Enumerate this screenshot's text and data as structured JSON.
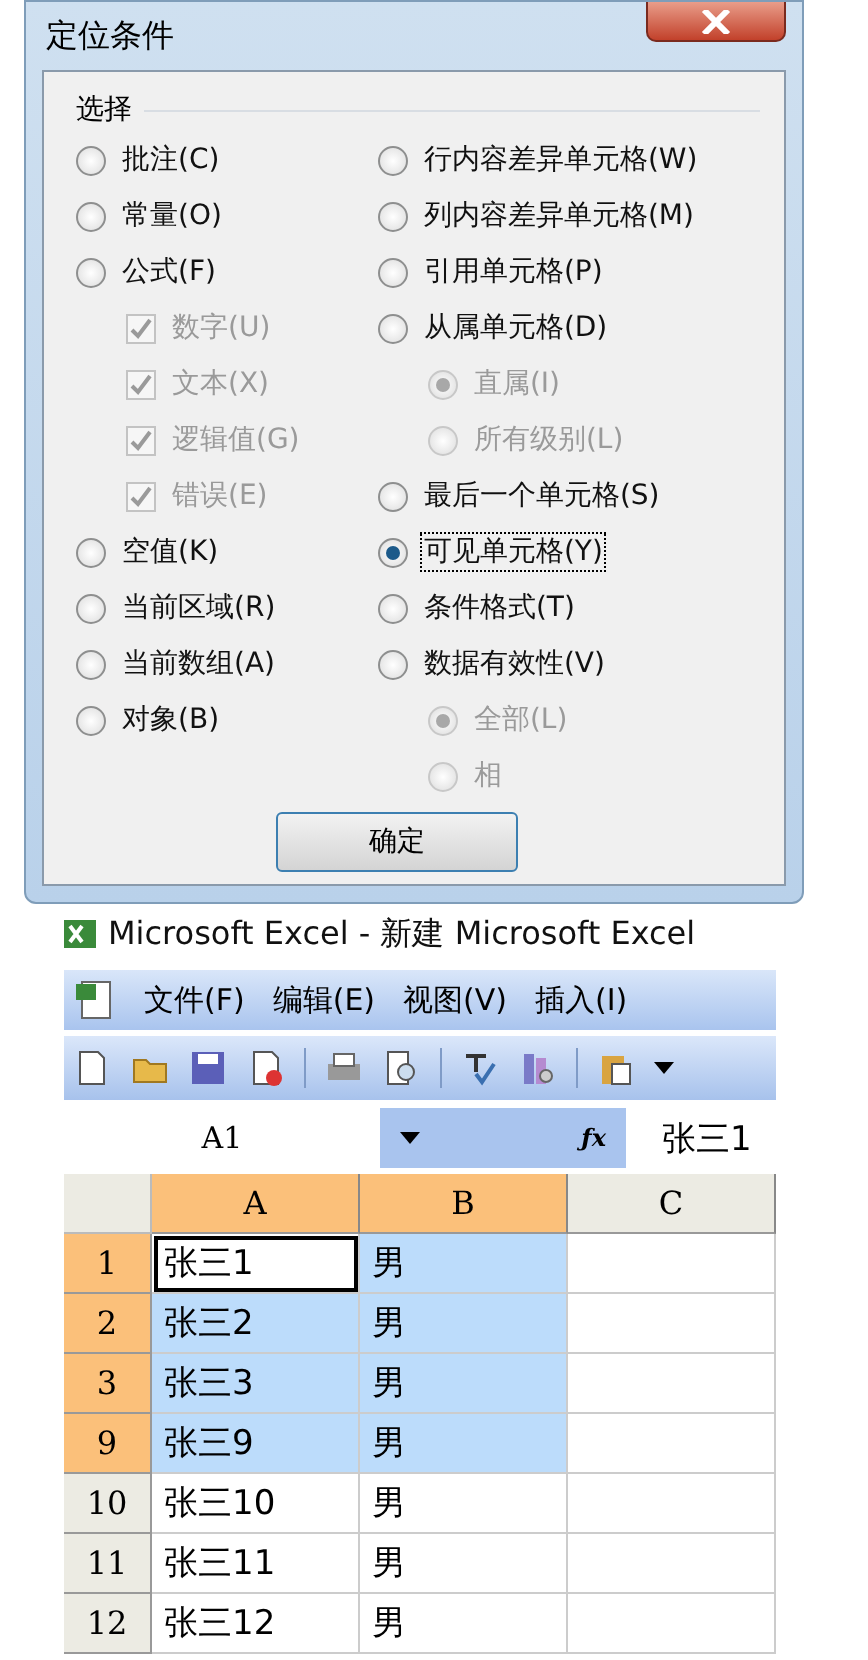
{
  "dialog": {
    "title": "定位条件",
    "group_label": "选择",
    "left_options": [
      {
        "label": "批注(C)",
        "kind": "radio",
        "selected": false,
        "disabled": false
      },
      {
        "label": "常量(O)",
        "kind": "radio",
        "selected": false,
        "disabled": false
      },
      {
        "label": "公式(F)",
        "kind": "radio",
        "selected": false,
        "disabled": false,
        "children": [
          {
            "label": "数字(U)",
            "kind": "checkbox",
            "checked": true,
            "disabled": true
          },
          {
            "label": "文本(X)",
            "kind": "checkbox",
            "checked": true,
            "disabled": true
          },
          {
            "label": "逻辑值(G)",
            "kind": "checkbox",
            "checked": true,
            "disabled": true
          },
          {
            "label": "错误(E)",
            "kind": "checkbox",
            "checked": true,
            "disabled": true
          }
        ]
      },
      {
        "label": "空值(K)",
        "kind": "radio",
        "selected": false,
        "disabled": false
      },
      {
        "label": "当前区域(R)",
        "kind": "radio",
        "selected": false,
        "disabled": false
      },
      {
        "label": "当前数组(A)",
        "kind": "radio",
        "selected": false,
        "disabled": false
      },
      {
        "label": "对象(B)",
        "kind": "radio",
        "selected": false,
        "disabled": false
      }
    ],
    "right_options": [
      {
        "label": "行内容差异单元格(W)",
        "kind": "radio",
        "selected": false,
        "disabled": false
      },
      {
        "label": "列内容差异单元格(M)",
        "kind": "radio",
        "selected": false,
        "disabled": false
      },
      {
        "label": "引用单元格(P)",
        "kind": "radio",
        "selected": false,
        "disabled": false
      },
      {
        "label": "从属单元格(D)",
        "kind": "radio",
        "selected": false,
        "disabled": false,
        "children": [
          {
            "label": "直属(I)",
            "kind": "radio",
            "selected": true,
            "disabled": true
          },
          {
            "label": "所有级别(L)",
            "kind": "radio",
            "selected": false,
            "disabled": true
          }
        ]
      },
      {
        "label": "最后一个单元格(S)",
        "kind": "radio",
        "selected": false,
        "disabled": false
      },
      {
        "label": "可见单元格(Y)",
        "kind": "radio",
        "selected": true,
        "disabled": false
      },
      {
        "label": "条件格式(T)",
        "kind": "radio",
        "selected": false,
        "disabled": false
      },
      {
        "label": "数据有效性(V)",
        "kind": "radio",
        "selected": false,
        "disabled": false,
        "children": [
          {
            "label": "全部(L)",
            "kind": "radio",
            "selected": true,
            "disabled": true
          },
          {
            "label": "相",
            "kind": "radio",
            "selected": false,
            "disabled": true
          }
        ]
      }
    ],
    "buttons": [
      {
        "label": "确定"
      }
    ]
  },
  "excel": {
    "title": "Microsoft Excel - 新建 Microsoft Excel",
    "menu": [
      "文件(F)",
      "编辑(E)",
      "视图(V)",
      "插入(I)"
    ],
    "name_box": "A1",
    "function_label": "ƒx",
    "formula": "张三1",
    "columns": [
      {
        "label": "A",
        "selected": true
      },
      {
        "label": "B",
        "selected": true
      },
      {
        "label": "C",
        "selected": false
      }
    ],
    "rows": [
      {
        "header": "1",
        "selected": true,
        "cells": [
          {
            "text": "张三1",
            "selected": true,
            "active": true
          },
          {
            "text": "男",
            "selected": true,
            "active": false
          }
        ]
      },
      {
        "header": "2",
        "selected": true,
        "cells": [
          {
            "text": "张三2",
            "selected": true,
            "active": false
          },
          {
            "text": "男",
            "selected": true,
            "active": false
          }
        ]
      },
      {
        "header": "3",
        "selected": true,
        "cells": [
          {
            "text": "张三3",
            "selected": true,
            "active": false
          },
          {
            "text": "男",
            "selected": true,
            "active": false
          }
        ]
      },
      {
        "header": "9",
        "selected": true,
        "cells": [
          {
            "text": "张三9",
            "selected": true,
            "active": false
          },
          {
            "text": "男",
            "selected": true,
            "active": false
          }
        ]
      },
      {
        "header": "10",
        "selected": false,
        "cells": [
          {
            "text": "张三10",
            "selected": false,
            "active": false
          },
          {
            "text": "男",
            "selected": false,
            "active": false
          }
        ]
      },
      {
        "header": "11",
        "selected": false,
        "cells": [
          {
            "text": "张三11",
            "selected": false,
            "active": false
          },
          {
            "text": "男",
            "selected": false,
            "active": false
          }
        ]
      },
      {
        "header": "12",
        "selected": false,
        "cells": [
          {
            "text": "张三12",
            "selected": false,
            "active": false
          },
          {
            "text": "男",
            "selected": false,
            "active": false
          }
        ]
      }
    ]
  }
}
